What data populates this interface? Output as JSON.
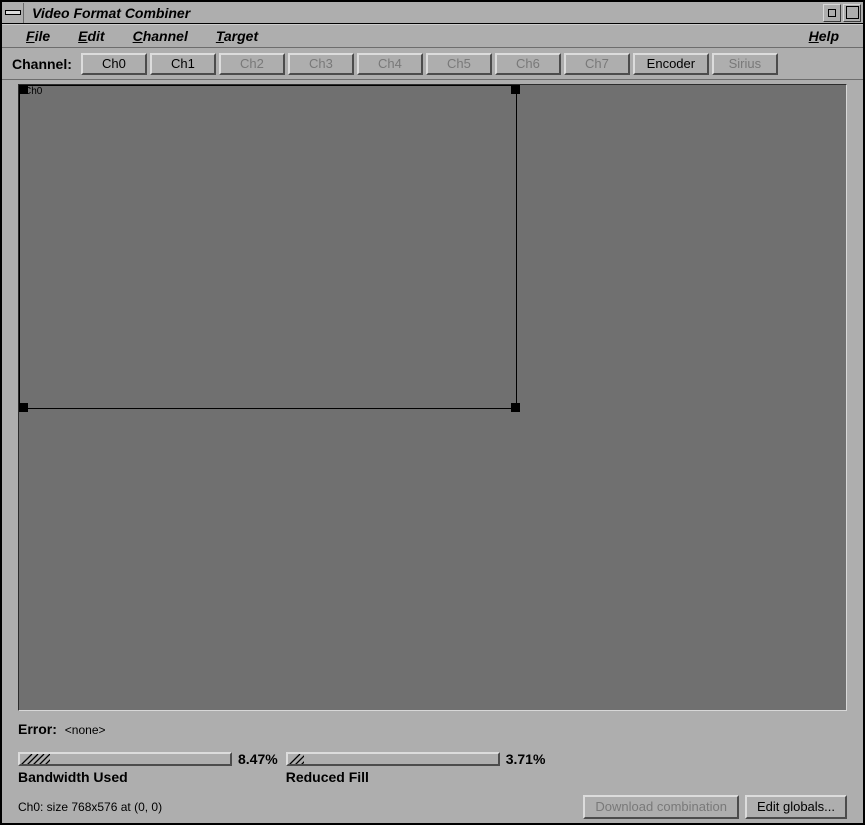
{
  "title": "Video Format Combiner",
  "menus": {
    "file": "File",
    "edit": "Edit",
    "channel": "Channel",
    "target": "Target",
    "help": "Help"
  },
  "toolbar": {
    "label": "Channel:",
    "buttons": {
      "ch0": "Ch0",
      "ch1": "Ch1",
      "ch2": "Ch2",
      "ch3": "Ch3",
      "ch4": "Ch4",
      "ch5": "Ch5",
      "ch6": "Ch6",
      "ch7": "Ch7",
      "encoder": "Encoder",
      "sirius": "Sirius"
    }
  },
  "canvas": {
    "rect_label": "Ch0"
  },
  "error": {
    "label": "Error:",
    "value": "<none>"
  },
  "meters": {
    "bandwidth": {
      "pct": "8.47%",
      "caption": "Bandwidth Used"
    },
    "fill": {
      "pct": "3.71%",
      "caption": "Reduced Fill"
    }
  },
  "status": "Ch0: size 768x576 at (0, 0)",
  "actions": {
    "download": "Download combination",
    "edit_globals": "Edit globals..."
  }
}
